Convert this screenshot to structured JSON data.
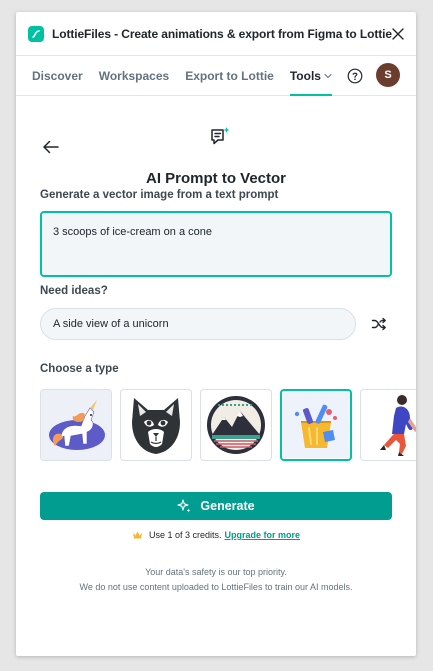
{
  "window": {
    "title": "LottieFiles - Create animations & export from Figma to Lottie"
  },
  "nav": {
    "tabs": [
      {
        "label": "Discover"
      },
      {
        "label": "Workspaces"
      },
      {
        "label": "Export to Lottie"
      },
      {
        "label": "Tools"
      }
    ],
    "active_tab": "Tools",
    "avatar_initial": "S"
  },
  "page": {
    "title": "AI Prompt to Vector",
    "prompt_label": "Generate a vector image from a text prompt",
    "prompt_value": "3 scoops of ice-cream on a cone",
    "ideas_label": "Need ideas?",
    "idea_suggestion": "A side view of a unicorn",
    "type_label": "Choose a type",
    "types": [
      {
        "icon": "unicorn-illustration-icon"
      },
      {
        "icon": "cat-face-icon"
      },
      {
        "icon": "mountain-badge-icon"
      },
      {
        "icon": "bucket-objects-icon"
      },
      {
        "icon": "walking-person-icon"
      }
    ],
    "selected_type_index": 3,
    "generate_label": "Generate",
    "credits_text": "Use 1 of 3 credits.",
    "upgrade_link": "Upgrade for more",
    "footer_line1": "Your data's safety is our top priority.",
    "footer_line2": "We do not use content uploaded to LottieFiles to train our AI models."
  },
  "colors": {
    "accent": "#00c1a2",
    "button": "#019d91",
    "avatar": "#6b3d2e"
  }
}
